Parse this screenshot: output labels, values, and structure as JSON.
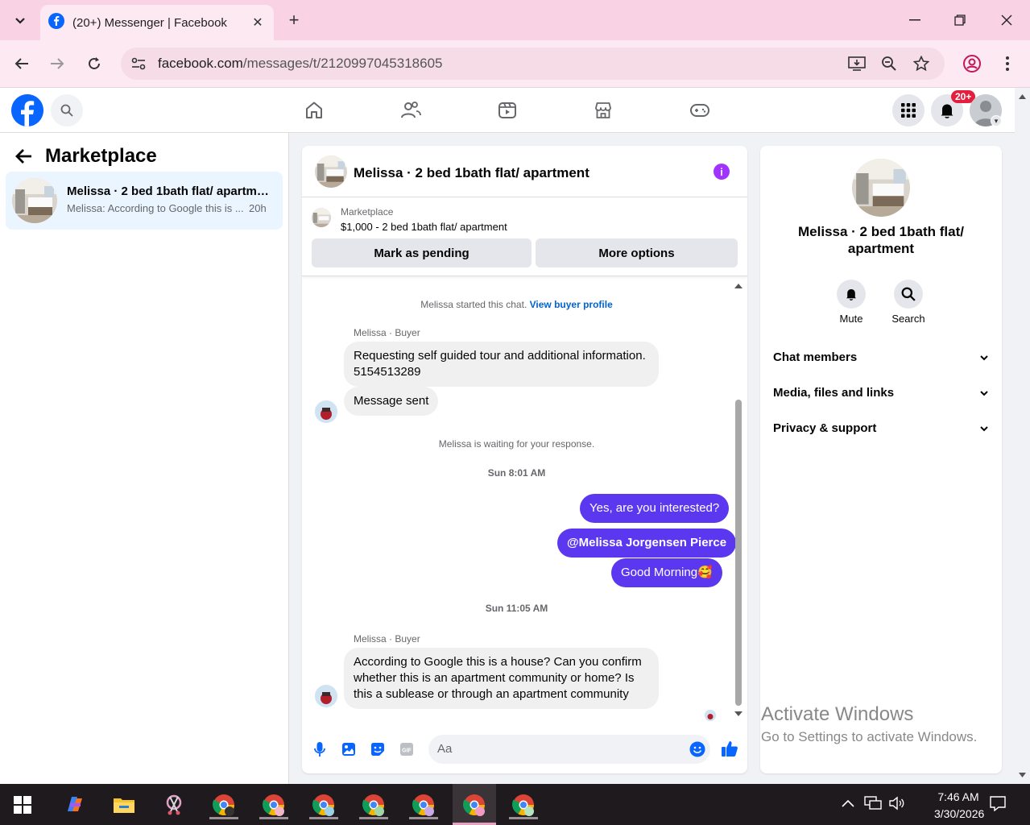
{
  "browser": {
    "tab_title": "(20+) Messenger | Facebook",
    "url_domain": "facebook.com",
    "url_path": "/messages/t/2120997045318605"
  },
  "header": {
    "notifications_badge": "20+"
  },
  "left_panel": {
    "title": "Marketplace",
    "conversations": [
      {
        "name": "Melissa · 2 bed 1bath flat/ apartme...",
        "snippet": "Melissa: According to Google this is ...",
        "time": "20h"
      }
    ]
  },
  "chat": {
    "title": "Melissa · 2 bed 1bath flat/ apartment",
    "listing": {
      "category": "Marketplace",
      "title": "$1,000 - 2 bed 1bath flat/ apartment",
      "pending_button": "Mark as pending",
      "more_button": "More options"
    },
    "system_started": "Melissa started this chat.",
    "view_profile": "View buyer profile",
    "sender_label": "Melissa · Buyer",
    "msg1": "Requesting self guided tour and additional information.",
    "msg1_line2": "5154513289",
    "msg2": "Message sent",
    "waiting": "Melissa is waiting for your response.",
    "ts1": "Sun 8:01 AM",
    "out1": "Yes, are you interested?",
    "out2": "@Melissa Jorgensen Pierce",
    "out3": "Good Morning🥰",
    "ts2": "Sun 11:05 AM",
    "sender_label2": "Melissa · Buyer",
    "msg3": "According to Google this is a house? Can you confirm whether this is an apartment community or home? Is this a sublease or through an apartment community",
    "composer_placeholder": "Aa"
  },
  "right_panel": {
    "name": "Melissa · 2 bed 1bath flat/ apartment",
    "mute": "Mute",
    "search": "Search",
    "sections": [
      "Chat members",
      "Media, files and links",
      "Privacy & support"
    ]
  },
  "watermark": {
    "line1": "Activate Windows",
    "line2": "Go to Settings to activate Windows."
  },
  "taskbar": {
    "time": "7:46 AM",
    "date": "3/30/2026"
  },
  "colors": {
    "fb_blue": "#0866ff",
    "outgoing_bubble": "#5b38f0",
    "badge_red": "#e41e3f",
    "selected_conv": "#ebf5ff"
  }
}
